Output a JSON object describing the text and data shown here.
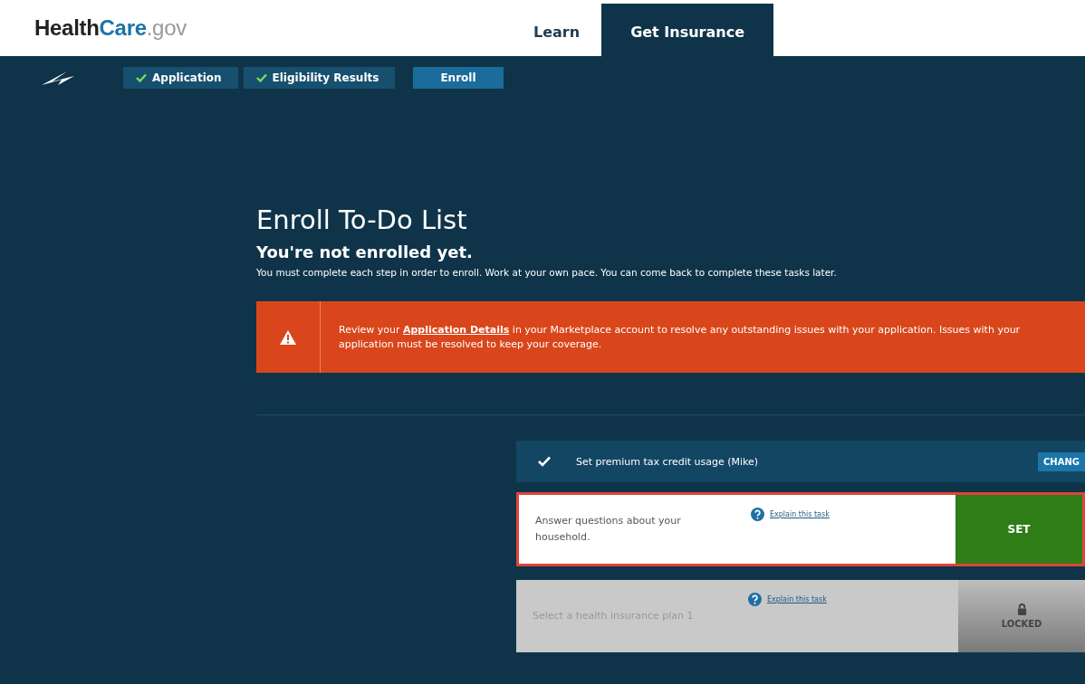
{
  "header": {
    "logo": {
      "brand": "Health",
      "brand_accent": "Care",
      "domain": ".gov"
    },
    "nav": [
      {
        "label": "Learn",
        "selected": false
      },
      {
        "label": "Get Insurance",
        "selected": true
      }
    ]
  },
  "steps": [
    {
      "label": "Application",
      "completed": true,
      "selected": false
    },
    {
      "label": "Eligibility Results",
      "completed": true,
      "selected": false
    },
    {
      "label": "Enroll",
      "completed": false,
      "selected": true
    }
  ],
  "page": {
    "title": "Enroll To-Do List",
    "subtitle": "You're not enrolled yet.",
    "intro": "You must complete each step in order to enroll. Work at your own pace. You can come back to complete these tasks later."
  },
  "alert": {
    "before": "Review your ",
    "link": "Application Details",
    "after": " in your Marketplace account to resolve any outstanding issues with your application. Issues with your application must be resolved to keep your coverage."
  },
  "tasks": [
    {
      "kind": "done",
      "label": "Set premium tax credit usage (Mike)",
      "action": "CHANG"
    },
    {
      "kind": "current",
      "label": "Answer questions about your household.",
      "help": "Explain this task",
      "action": "SET"
    },
    {
      "kind": "locked",
      "label": "Select a health insurance plan 1",
      "help": "Explain this task",
      "action": "LOCKED"
    }
  ]
}
